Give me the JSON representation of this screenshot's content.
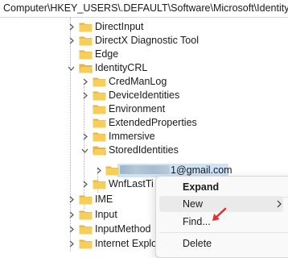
{
  "address_bar": {
    "path": "Computer\\HKEY_USERS\\.DEFAULT\\Software\\Microsoft\\IdentityCRL"
  },
  "tree": {
    "items": [
      {
        "label": "DirectInput",
        "expander": "right"
      },
      {
        "label": "DirectX Diagnostic Tool",
        "expander": "right"
      },
      {
        "label": "Edge",
        "expander": "none"
      },
      {
        "label": "IdentityCRL",
        "expander": "down"
      },
      {
        "label": "CredManLog",
        "expander": "right"
      },
      {
        "label": "DeviceIdentities",
        "expander": "right"
      },
      {
        "label": "Environment",
        "expander": "none"
      },
      {
        "label": "ExtendedProperties",
        "expander": "none"
      },
      {
        "label": "Immersive",
        "expander": "right"
      },
      {
        "label": "StoredIdentities",
        "expander": "down"
      },
      {
        "label": "1@gmail.com",
        "expander": "right",
        "selected": true
      },
      {
        "label": "WnfLastTi",
        "expander": "right"
      },
      {
        "label": "IME",
        "expander": "right"
      },
      {
        "label": "Input",
        "expander": "right"
      },
      {
        "label": "InputMethod",
        "expander": "right"
      },
      {
        "label": "Internet Explo",
        "expander": "right"
      }
    ]
  },
  "context_menu": {
    "items": [
      {
        "label": "Expand",
        "bold": true
      },
      {
        "label": "New",
        "submenu": true,
        "hover": true
      },
      {
        "label": "Find..."
      },
      {
        "label": "Delete"
      }
    ]
  },
  "colors": {
    "selection": "#cce4f7",
    "folder": "#f0c24c",
    "annotation_arrow": "#e03030"
  },
  "icons": {
    "folder": "folder-icon",
    "expand": "chevron-right-icon",
    "collapse": "chevron-down-icon"
  }
}
